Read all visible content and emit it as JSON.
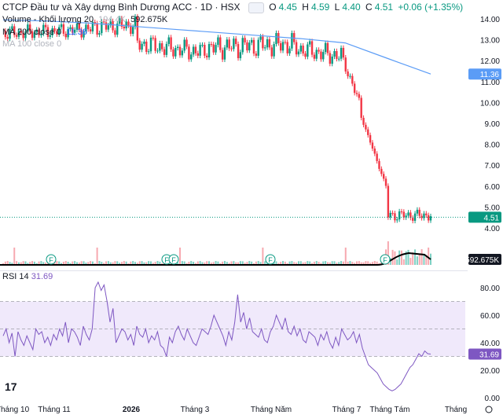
{
  "header": {
    "title": "CTCP Đầu tư và Xây dựng Bình Dương ACC · 1D · HSX",
    "ohlc": {
      "o_label": "O",
      "o": "4.45",
      "h_label": "H",
      "h": "4.59",
      "l_label": "L",
      "l": "4.40",
      "c_label": "C",
      "c": "4.51",
      "change": "+0.06 (+1.35%)"
    },
    "volume_label": "Volume - Khối lượng 20",
    "volume_ma": "194.4K",
    "volume_value": "592.675K",
    "ma200_label": "MA 200 close 0",
    "ma200_value": "11.36",
    "ma100_label": "MA 100 close 0"
  },
  "rsi_header": {
    "label": "RSI 14",
    "value": "31.69"
  },
  "logo": "17",
  "colors": {
    "up": "#089981",
    "down": "#f23645",
    "ma": "#5b9cf6",
    "rsi": "#7e57c2",
    "rsi_band": "#f0e9fb",
    "volume_ma": "#000000",
    "price_line": "#089981",
    "ma_badge": "#5b9cf6",
    "rsi_badge": "#7e57c2",
    "vol_badge": "#131722"
  },
  "chart_data": [
    {
      "type": "candlestick",
      "price_axis": {
        "ticks": [
          "14.00",
          "13.00",
          "12.00",
          "11.00",
          "10.00",
          "9.00",
          "8.00",
          "7.00",
          "6.00",
          "5.00",
          "4.00"
        ],
        "ylim": [
          3.5,
          14.6
        ]
      },
      "x_axis": {
        "labels": [
          "Tháng 10",
          "Tháng 11",
          "2026",
          "Tháng 3",
          "Tháng Năm",
          "Tháng 7",
          "Tháng Tám",
          "Tháng"
        ]
      },
      "last_price": "4.51",
      "ma200_badge": "11.36",
      "ma200": [
        13.95,
        13.9,
        13.8,
        13.65,
        13.5,
        13.35,
        13.2,
        13.05,
        12.85,
        12.1,
        11.36
      ],
      "segments": [
        {
          "n": 40,
          "start": 13.3,
          "end": 13.5,
          "noise": 0.25
        },
        {
          "n": 20,
          "start": 13.6,
          "end": 13.7,
          "noise": 0.3
        },
        {
          "n": 30,
          "start": 12.8,
          "end": 12.4,
          "noise": 0.35
        },
        {
          "n": 40,
          "start": 12.6,
          "end": 12.8,
          "noise": 0.4
        },
        {
          "n": 22,
          "start": 12.6,
          "end": 12.2,
          "noise": 0.35
        },
        {
          "n": 8,
          "start": 12.0,
          "end": 10.0,
          "noise": 0.2
        },
        {
          "n": 12,
          "start": 9.3,
          "end": 6.0,
          "noise": 0.05
        },
        {
          "n": 20,
          "start": 4.6,
          "end": 4.6,
          "noise": 0.2
        }
      ],
      "markers": [
        "F",
        "F",
        "F",
        "F",
        "F"
      ],
      "volume_badge": "592.675K"
    },
    {
      "type": "line",
      "name": "RSI 14",
      "axis_ticks": [
        "80.00",
        "60.00",
        "40.00",
        "20.00",
        "0.00"
      ],
      "ylim": [
        0,
        88
      ],
      "bands": [
        70,
        50,
        30
      ],
      "last_value": "31.69",
      "values": [
        45,
        50,
        40,
        47,
        30,
        48,
        42,
        38,
        45,
        40,
        35,
        50,
        46,
        48,
        40,
        44,
        38,
        46,
        42,
        50,
        45,
        55,
        40,
        50,
        48,
        44,
        38,
        52,
        46,
        42,
        50,
        80,
        84,
        78,
        82,
        70,
        55,
        65,
        40,
        45,
        50,
        48,
        42,
        46,
        38,
        52,
        46,
        44,
        50,
        40,
        45,
        42,
        48,
        38,
        36,
        30,
        44,
        40,
        48,
        52,
        46,
        42,
        50,
        45,
        40,
        38,
        44,
        50,
        48,
        46,
        52,
        60,
        55,
        50,
        45,
        38,
        48,
        42,
        55,
        75,
        55,
        62,
        50,
        58,
        48,
        46,
        44,
        50,
        42,
        40,
        48,
        52,
        60,
        55,
        50,
        58,
        48,
        46,
        52,
        45,
        50,
        42,
        40,
        48,
        46,
        44,
        38,
        46,
        42,
        48,
        40,
        36,
        44,
        38,
        50,
        46,
        42,
        44,
        48,
        40,
        46,
        36,
        30,
        24,
        22,
        20,
        18,
        14,
        10,
        8,
        6,
        5,
        6,
        8,
        10,
        14,
        18,
        22,
        24,
        28,
        32,
        30,
        34,
        32,
        31.69
      ]
    }
  ]
}
